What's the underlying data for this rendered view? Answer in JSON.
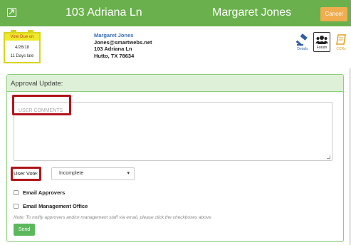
{
  "header": {
    "address": "103 Adriana Ln",
    "owner": "Margaret Jones",
    "cancel_label": "Cancel",
    "menu_icon": "expand-square-icon",
    "brand_color": "#6ab04c",
    "cancel_color": "#f0ad4e"
  },
  "due_card": {
    "label": "Vote Due on",
    "date": "4/26/18",
    "late": "11 Days late"
  },
  "contact": {
    "name": "Margaret Jones",
    "email": "Jones@smartwebs.net",
    "street": "103 Adriana Ln",
    "city": "Hutto, TX 78634"
  },
  "actions": {
    "details_label": "Details",
    "forum_label": "Forum",
    "ccrs_label": "CCRs",
    "details_icon": "gavel-icon",
    "forum_icon": "users-icon",
    "ccrs_icon": "book-icon"
  },
  "approval": {
    "title": "Approval Update:",
    "comments_placeholder": "USER COMMENTS",
    "vote_label": "User Vote:",
    "vote_value": "Incomplete",
    "email_approvers_label": "Email Approvers",
    "email_mgmt_label": "Email Management Office",
    "note": "Note: To notify approvers and/or management staff via email, please click the checkboxes above",
    "send_label": "Send"
  }
}
